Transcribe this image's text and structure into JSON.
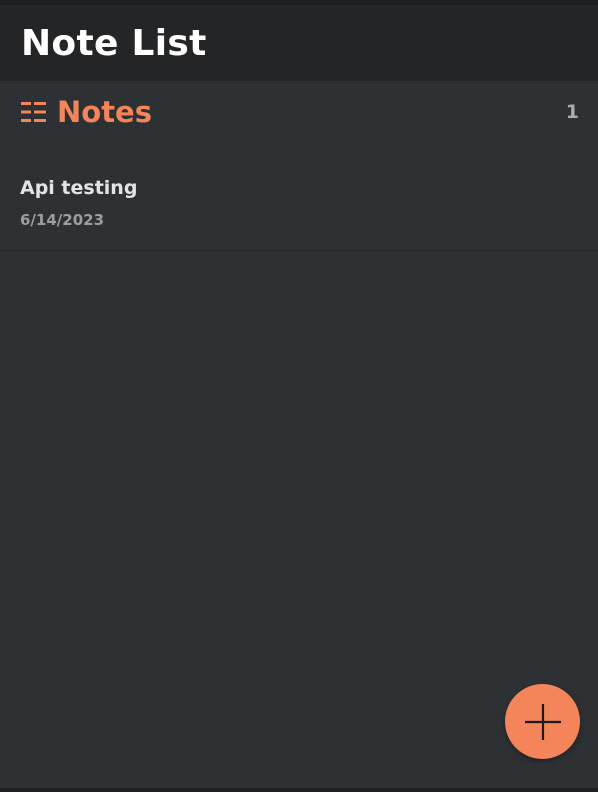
{
  "header": {
    "title": "Note List"
  },
  "section": {
    "icon": "list-icon",
    "title": "Notes",
    "count": "1"
  },
  "notes": [
    {
      "title": "Api testing",
      "date": "6/14/2023"
    }
  ],
  "fab": {
    "icon": "plus-icon"
  },
  "colors": {
    "accent": "#f4845a",
    "background": "#2e3134",
    "header_background": "#242526"
  }
}
